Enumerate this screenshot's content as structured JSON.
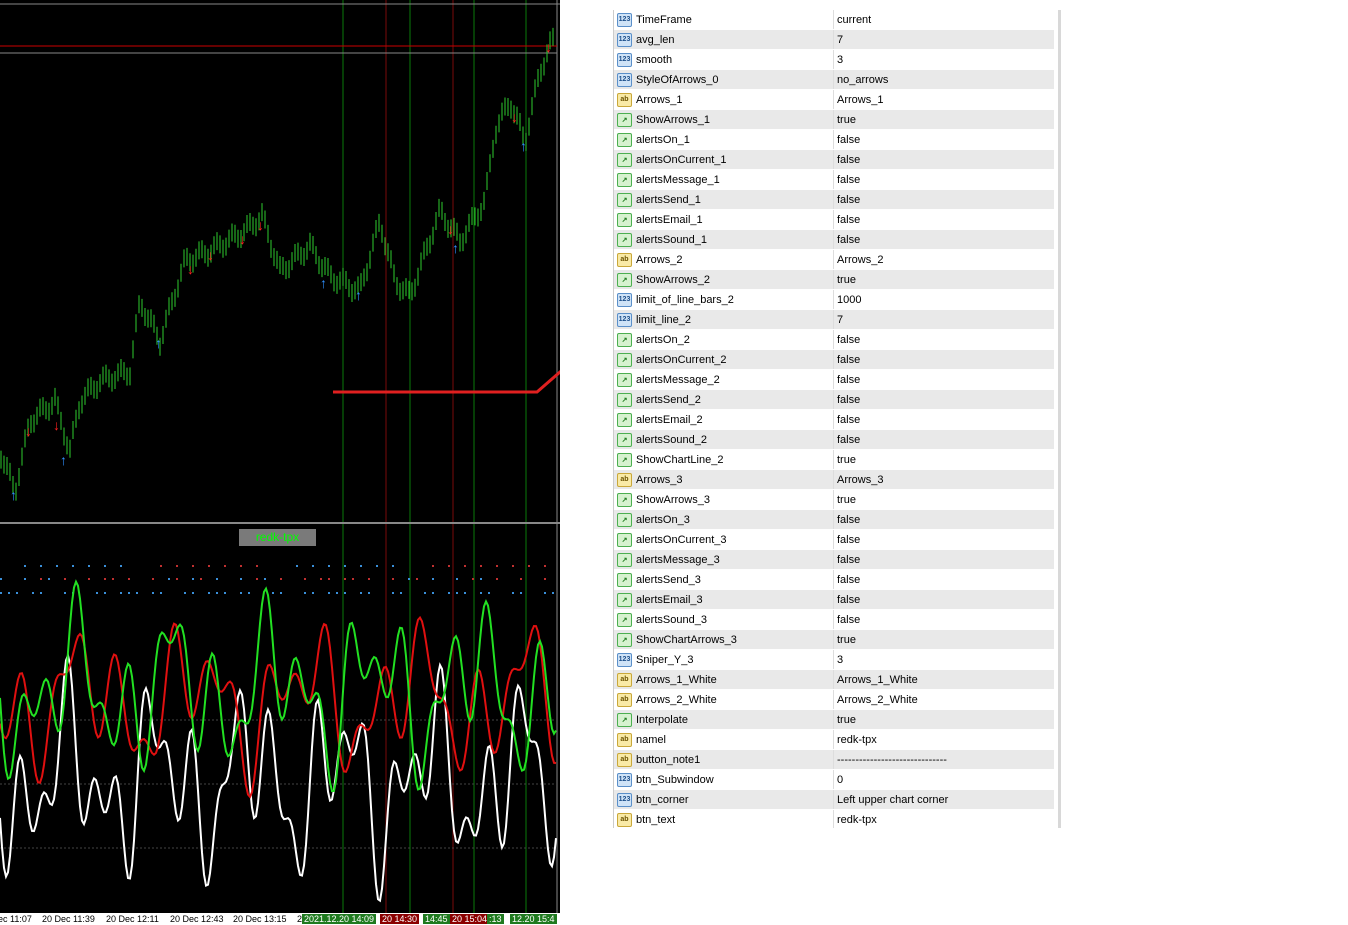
{
  "chart": {
    "subwindow_label": "redk-tpx",
    "time_axis": [
      "ec 11:07",
      "20 Dec 11:39",
      "20 Dec 12:11",
      "20 Dec 12:43",
      "20 Dec 13:15",
      "2"
    ],
    "time_axis_highlights": [
      {
        "text": "2021.12.20 14:09",
        "color": "#1f7a1f"
      },
      {
        "text": "20 14:30",
        "color": "#8b0000"
      },
      {
        "text": "14:45",
        "color": "#1f7a1f"
      },
      {
        "text": "20 15:04",
        "color": "#8b0000"
      },
      {
        "text": ":13",
        "color": "#1f7a1f"
      },
      {
        "text": "12.20 15:4",
        "color": "#1f7a1f"
      }
    ]
  },
  "properties": [
    {
      "type": "123",
      "name": "TimeFrame",
      "value": "current"
    },
    {
      "type": "123",
      "name": "avg_len",
      "value": "7"
    },
    {
      "type": "123",
      "name": "smooth",
      "value": "3"
    },
    {
      "type": "123",
      "name": "StyleOfArrows_0",
      "value": "no_arrows"
    },
    {
      "type": "ab",
      "name": "Arrows_1",
      "value": "Arrows_1"
    },
    {
      "type": "bool",
      "name": "ShowArrows_1",
      "value": "true"
    },
    {
      "type": "bool",
      "name": "alertsOn_1",
      "value": "false"
    },
    {
      "type": "bool",
      "name": "alertsOnCurrent_1",
      "value": "false"
    },
    {
      "type": "bool",
      "name": "alertsMessage_1",
      "value": "false"
    },
    {
      "type": "bool",
      "name": "alertsSend_1",
      "value": "false"
    },
    {
      "type": "bool",
      "name": "alertsEmail_1",
      "value": "false"
    },
    {
      "type": "bool",
      "name": "alertsSound_1",
      "value": "false"
    },
    {
      "type": "ab",
      "name": "Arrows_2",
      "value": "Arrows_2"
    },
    {
      "type": "bool",
      "name": "ShowArrows_2",
      "value": "true"
    },
    {
      "type": "123",
      "name": "limit_of_line_bars_2",
      "value": "1000"
    },
    {
      "type": "123",
      "name": "limit_line_2",
      "value": "7"
    },
    {
      "type": "bool",
      "name": "alertsOn_2",
      "value": "false"
    },
    {
      "type": "bool",
      "name": "alertsOnCurrent_2",
      "value": "false"
    },
    {
      "type": "bool",
      "name": "alertsMessage_2",
      "value": "false"
    },
    {
      "type": "bool",
      "name": "alertsSend_2",
      "value": "false"
    },
    {
      "type": "bool",
      "name": "alertsEmail_2",
      "value": "false"
    },
    {
      "type": "bool",
      "name": "alertsSound_2",
      "value": "false"
    },
    {
      "type": "bool",
      "name": "ShowChartLine_2",
      "value": "true"
    },
    {
      "type": "ab",
      "name": "Arrows_3",
      "value": "Arrows_3"
    },
    {
      "type": "bool",
      "name": "ShowArrows_3",
      "value": "true"
    },
    {
      "type": "bool",
      "name": "alertsOn_3",
      "value": "false"
    },
    {
      "type": "bool",
      "name": "alertsOnCurrent_3",
      "value": "false"
    },
    {
      "type": "bool",
      "name": "alertsMessage_3",
      "value": "false"
    },
    {
      "type": "bool",
      "name": "alertsSend_3",
      "value": "false"
    },
    {
      "type": "bool",
      "name": "alertsEmail_3",
      "value": "false"
    },
    {
      "type": "bool",
      "name": "alertsSound_3",
      "value": "false"
    },
    {
      "type": "bool",
      "name": "ShowChartArrows_3",
      "value": "true"
    },
    {
      "type": "123",
      "name": "Sniper_Y_3",
      "value": "3"
    },
    {
      "type": "ab",
      "name": "Arrows_1_White",
      "value": "Arrows_1_White"
    },
    {
      "type": "ab",
      "name": "Arrows_2_White",
      "value": "Arrows_2_White"
    },
    {
      "type": "bool",
      "name": "Interpolate",
      "value": "true"
    },
    {
      "type": "ab",
      "name": "namel",
      "value": "redk-tpx"
    },
    {
      "type": "ab",
      "name": "button_note1",
      "value": "------------------------------"
    },
    {
      "type": "123",
      "name": "btn_Subwindow",
      "value": "0"
    },
    {
      "type": "123",
      "name": "btn_corner",
      "value": "Left upper chart corner"
    },
    {
      "type": "ab",
      "name": "btn_text",
      "value": "redk-tpx"
    }
  ]
}
